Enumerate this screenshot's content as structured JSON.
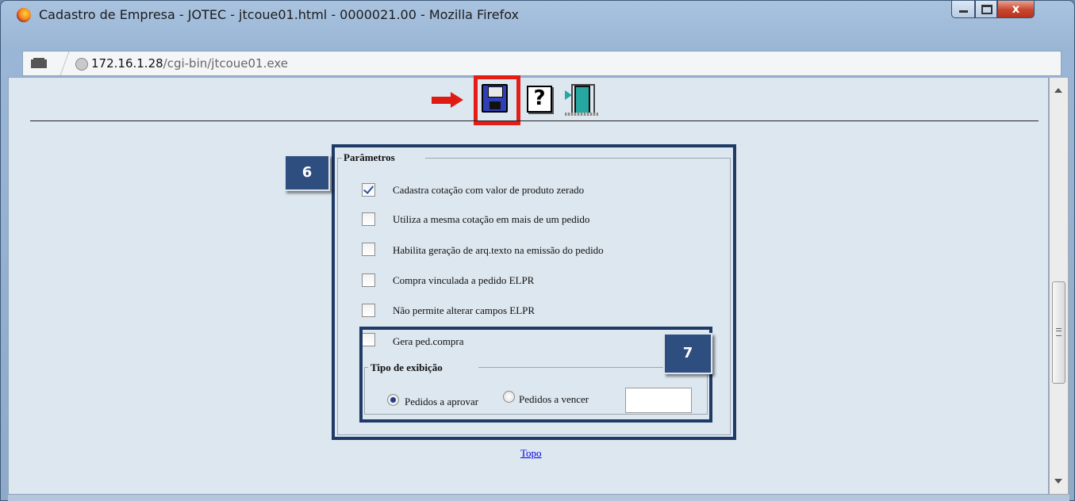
{
  "window": {
    "title": "Cadastro de Empresa - JOTEC - jtcoue01.html - 0000021.00 - Mozilla Firefox",
    "close_glyph": "x"
  },
  "address_bar": {
    "url_host": "172.16.1.28",
    "url_path": "/cgi-bin/jtcoue01.exe"
  },
  "toolbar": {
    "help_glyph": "?",
    "icons": [
      "save-icon",
      "help-icon",
      "exit-icon"
    ]
  },
  "parametros": {
    "legend": "Parâmetros",
    "badge": "6",
    "options": [
      {
        "label": "Cadastra cotação com valor de produto zerado",
        "checked": true
      },
      {
        "label": "Utiliza a mesma cotação em mais de um pedido",
        "checked": false
      },
      {
        "label": "Habilita geração de arq.texto na emissão do pedido",
        "checked": false
      },
      {
        "label": "Compra vinculada a pedido ELPR",
        "checked": false
      },
      {
        "label": "Não permite alterar campos ELPR",
        "checked": false
      },
      {
        "label": "Gera ped.compra",
        "checked": false
      }
    ]
  },
  "tipo_exibicao": {
    "legend": "Tipo de exibição",
    "badge": "7",
    "options": [
      {
        "label": "Pedidos a aprovar",
        "selected": true
      },
      {
        "label": "Pedidos a vencer",
        "selected": false
      }
    ],
    "vencer_value": ""
  },
  "footer": {
    "topo_link": "Topo"
  },
  "colors": {
    "highlight_red": "#e41d17",
    "badge_blue": "#2d4e7e",
    "frame_blue": "#1f3a66",
    "page_bg": "#dde7ef"
  }
}
